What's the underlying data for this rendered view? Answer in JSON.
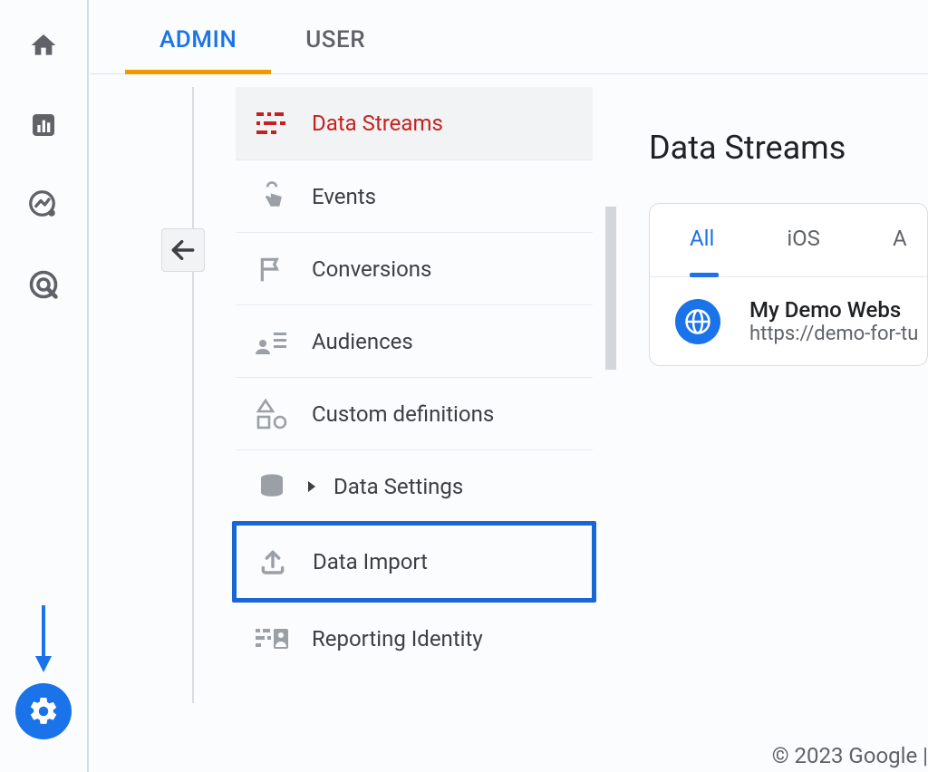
{
  "topTabs": {
    "admin": "ADMIN",
    "user": "USER"
  },
  "menu": {
    "dataStreams": "Data Streams",
    "events": "Events",
    "conversions": "Conversions",
    "audiences": "Audiences",
    "customDefinitions": "Custom definitions",
    "dataSettings": "Data Settings",
    "dataImport": "Data Import",
    "reportingIdentity": "Reporting Identity"
  },
  "content": {
    "title": "Data Streams",
    "tabs": {
      "all": "All",
      "ios": "iOS",
      "android": "A"
    },
    "stream": {
      "name": "My Demo Webs",
      "url": "https://demo-for-tu"
    }
  },
  "footer": "© 2023 Google |"
}
